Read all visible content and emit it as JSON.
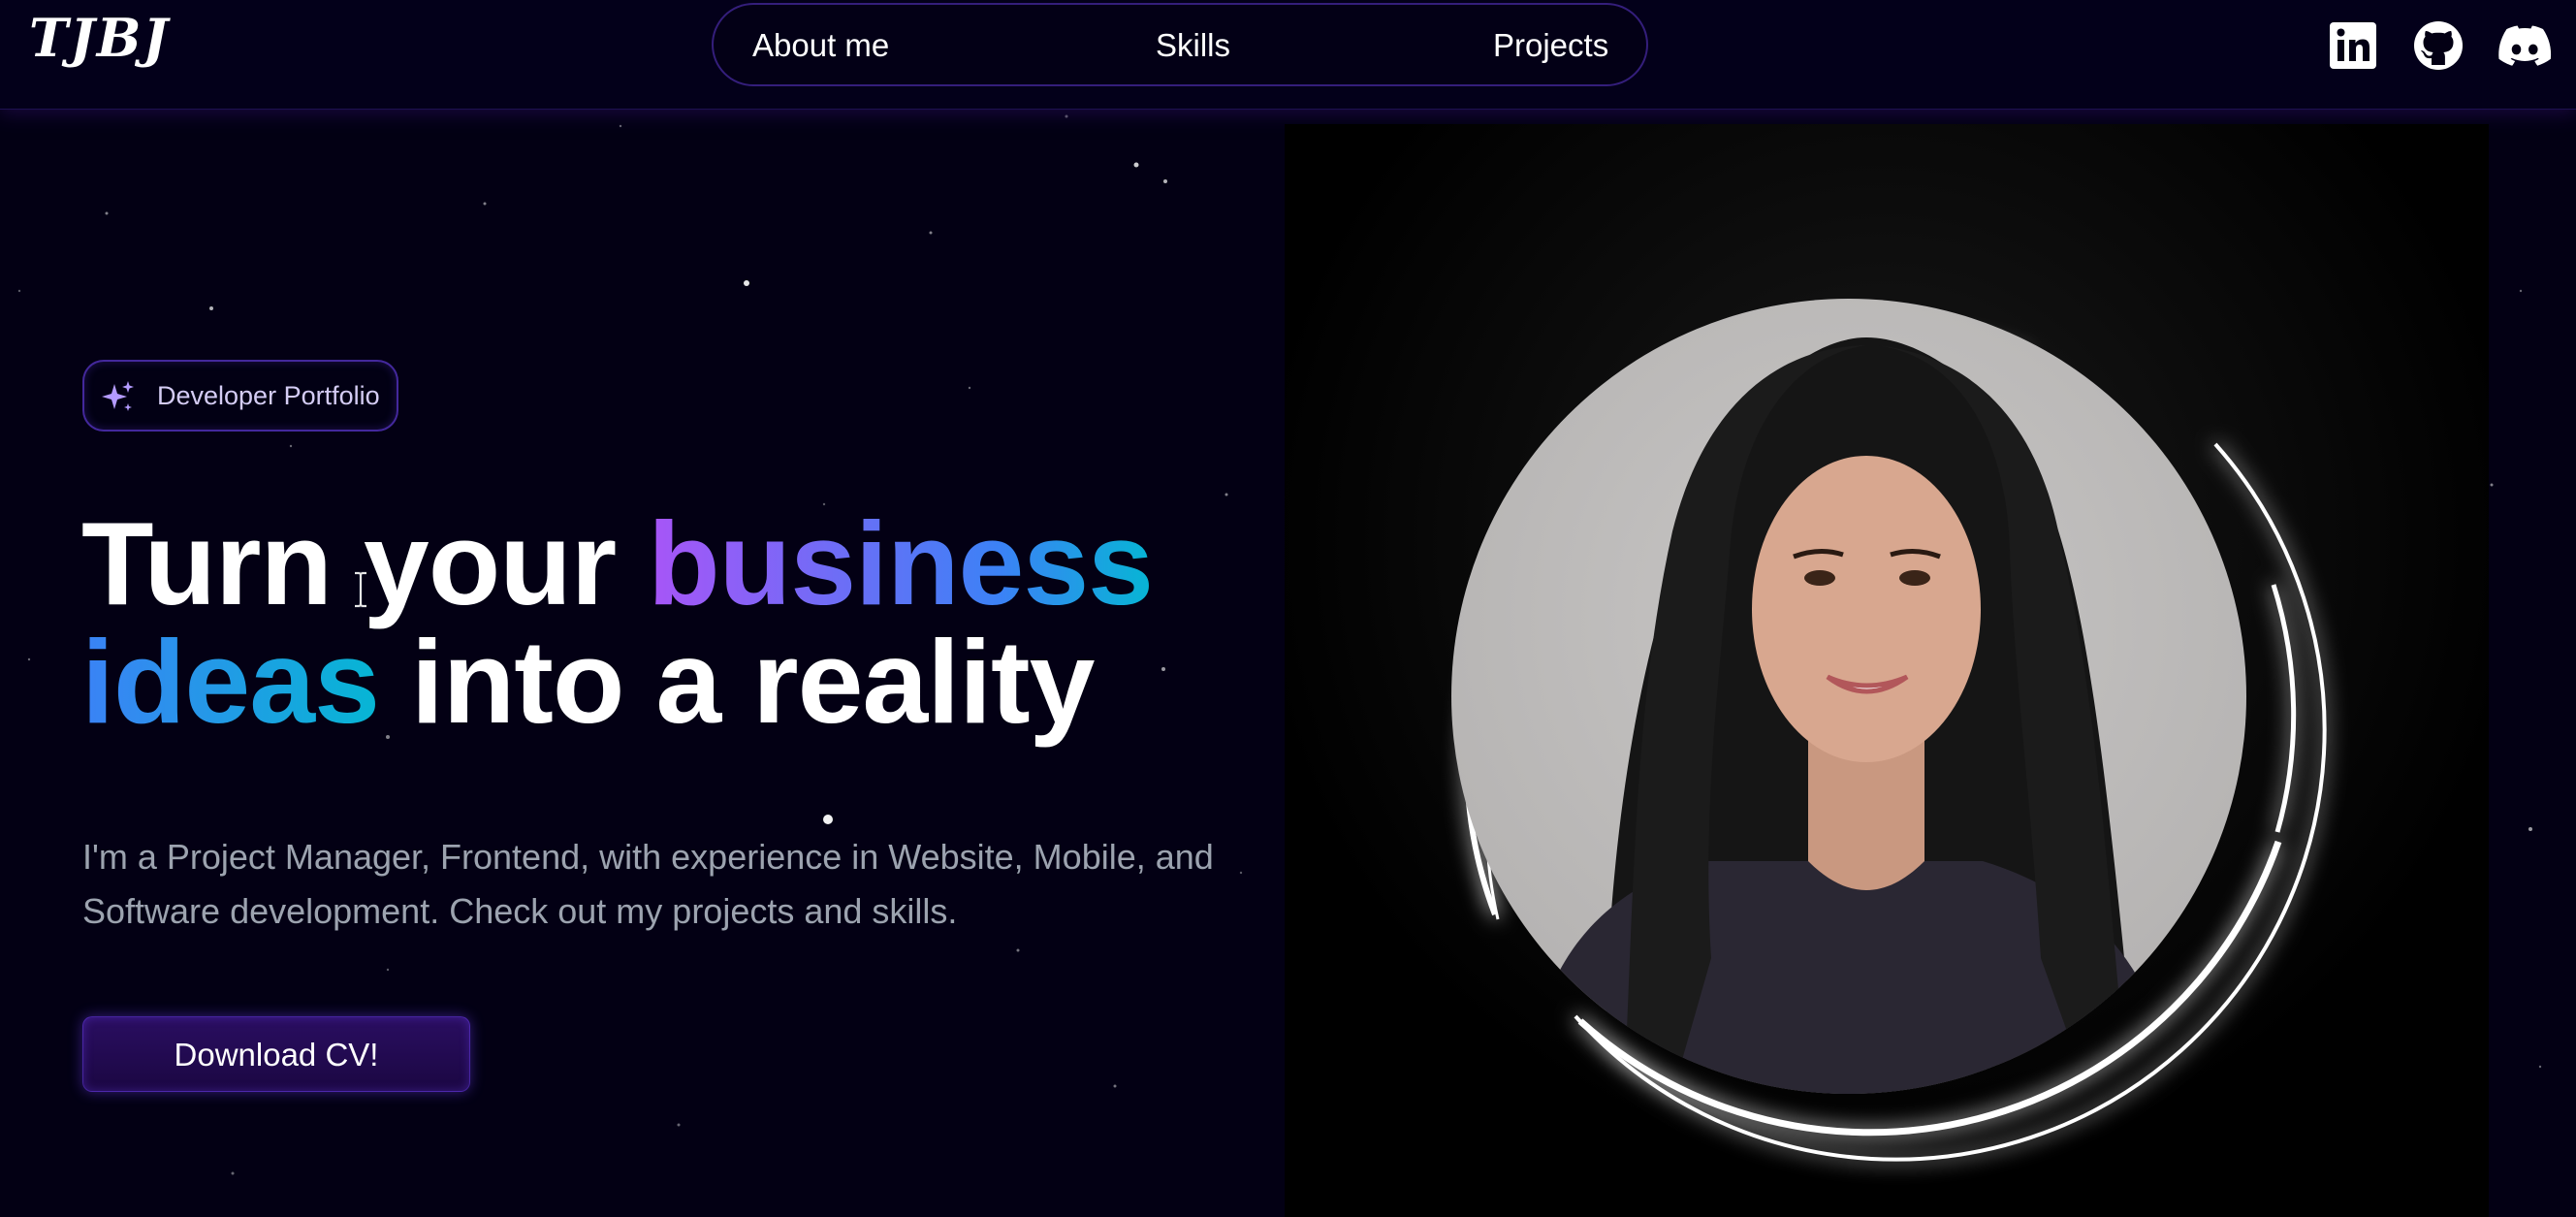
{
  "header": {
    "logo": "TJBJ",
    "nav": [
      {
        "label": "About me"
      },
      {
        "label": "Skills"
      },
      {
        "label": "Projects"
      }
    ],
    "social": [
      "linkedin-icon",
      "github-icon",
      "discord-icon"
    ]
  },
  "hero": {
    "badge": {
      "icon": "sparkles-icon",
      "label": "Developer Portfolio"
    },
    "headline": {
      "line1_a": "Turn your ",
      "line1_b": "business",
      "line2_a": "ideas",
      "line2_b": " into a reality"
    },
    "description": "I'm a Project Manager, Frontend, with experience in Website, Mobile, and Software development. Check out my projects and skills.",
    "cta": "Download CV!"
  },
  "colors": {
    "background": "#030014",
    "accent_purple": "#a855f7",
    "accent_blue": "#3b82f6",
    "accent_cyan": "#06b6d4",
    "button": "#2a0e61"
  }
}
